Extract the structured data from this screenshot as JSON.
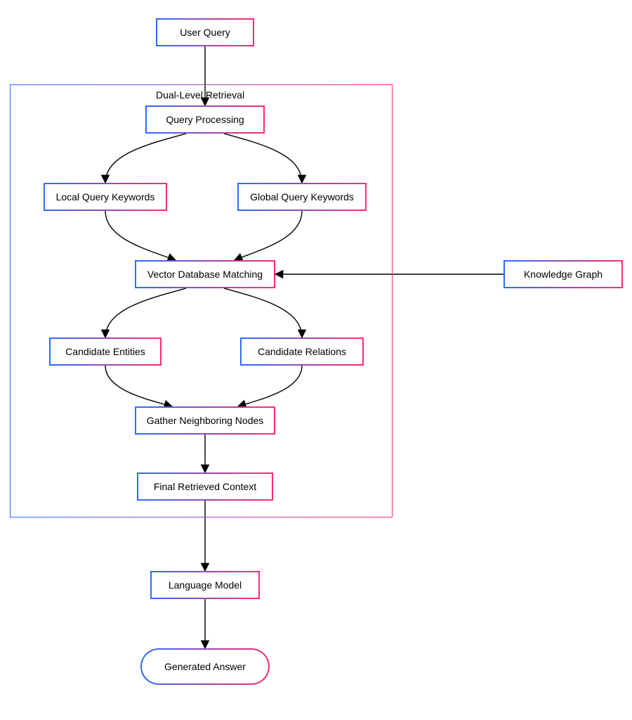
{
  "diagram": {
    "container_label": "Dual-Level Retrieval",
    "nodes": {
      "user_query": "User Query",
      "query_processing": "Query Processing",
      "local_keywords": "Local Query Keywords",
      "global_keywords": "Global Query Keywords",
      "vector_matching": "Vector Database Matching",
      "knowledge_graph": "Knowledge Graph",
      "candidate_entities": "Candidate Entities",
      "candidate_relations": "Candidate Relations",
      "gather_nodes": "Gather Neighboring Nodes",
      "final_context": "Final Retrieved Context",
      "language_model": "Language Model",
      "generated_answer": "Generated Answer"
    },
    "edges": [
      {
        "from": "user_query",
        "to": "query_processing"
      },
      {
        "from": "query_processing",
        "to": "local_keywords"
      },
      {
        "from": "query_processing",
        "to": "global_keywords"
      },
      {
        "from": "local_keywords",
        "to": "vector_matching"
      },
      {
        "from": "global_keywords",
        "to": "vector_matching"
      },
      {
        "from": "knowledge_graph",
        "to": "vector_matching"
      },
      {
        "from": "vector_matching",
        "to": "candidate_entities"
      },
      {
        "from": "vector_matching",
        "to": "candidate_relations"
      },
      {
        "from": "candidate_entities",
        "to": "gather_nodes"
      },
      {
        "from": "candidate_relations",
        "to": "gather_nodes"
      },
      {
        "from": "gather_nodes",
        "to": "final_context"
      },
      {
        "from": "final_context",
        "to": "language_model"
      },
      {
        "from": "language_model",
        "to": "generated_answer"
      }
    ]
  }
}
